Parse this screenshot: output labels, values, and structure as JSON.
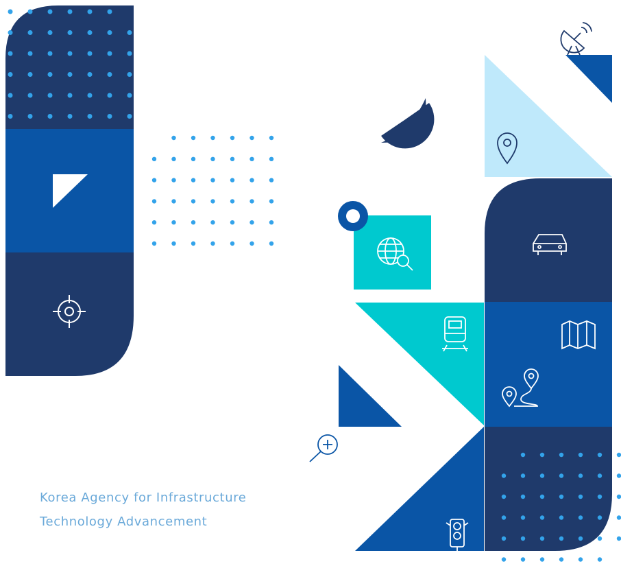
{
  "organization": {
    "name_line1": "Korea Agency for Infrastructure",
    "name_line2": "Technology Advancement"
  },
  "colors": {
    "navy": "#1f3a6b",
    "blue": "#0a55a6",
    "cyan": "#00c9cf",
    "light_blue": "#bfe9fb",
    "dot_blue": "#33a3ea",
    "text": "#6aa9d9"
  },
  "icons": [
    "satellite-dish-icon",
    "map-pin-icon",
    "crosshair-icon",
    "globe-search-icon",
    "car-icon",
    "train-icon",
    "folded-map-icon",
    "route-icon",
    "zoom-in-icon",
    "traffic-light-icon"
  ]
}
